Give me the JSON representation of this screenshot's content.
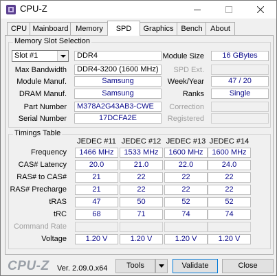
{
  "window": {
    "title": "CPU-Z",
    "icon": "cpu-z-app-icon"
  },
  "tabs": [
    {
      "label": "CPU"
    },
    {
      "label": "Mainboard"
    },
    {
      "label": "Memory"
    },
    {
      "label": "SPD",
      "active": true
    },
    {
      "label": "Graphics"
    },
    {
      "label": "Bench"
    },
    {
      "label": "About"
    }
  ],
  "slot": {
    "group_title": "Memory Slot Selection",
    "selected": "Slot #1",
    "type": "DDR4",
    "module_size_label": "Module Size",
    "module_size": "16 GBytes",
    "max_bandwidth_label": "Max Bandwidth",
    "max_bandwidth": "DDR4-3200 (1600 MHz)",
    "spd_ext_label": "SPD Ext.",
    "spd_ext": "",
    "manuf_label": "Module Manuf.",
    "manuf": "Samsung",
    "week_year_label": "Week/Year",
    "week_year": "47 / 20",
    "dram_manuf_label": "DRAM Manuf.",
    "dram_manuf": "Samsung",
    "ranks_label": "Ranks",
    "ranks": "Single",
    "part_label": "Part Number",
    "part": "M378A2G43AB3-CWE",
    "correction_label": "Correction",
    "correction": "",
    "serial_label": "Serial Number",
    "serial": "17DCFA2E",
    "registered_label": "Registered",
    "registered": ""
  },
  "timings": {
    "group_title": "Timings Table",
    "columns": [
      "JEDEC #11",
      "JEDEC #12",
      "JEDEC #13",
      "JEDEC #14"
    ],
    "rows": [
      {
        "label": "Frequency",
        "values": [
          "1466 MHz",
          "1533 MHz",
          "1600 MHz",
          "1600 MHz"
        ]
      },
      {
        "label": "CAS# Latency",
        "values": [
          "20.0",
          "21.0",
          "22.0",
          "24.0"
        ]
      },
      {
        "label": "RAS# to CAS#",
        "values": [
          "21",
          "22",
          "22",
          "22"
        ]
      },
      {
        "label": "RAS# Precharge",
        "values": [
          "21",
          "22",
          "22",
          "22"
        ]
      },
      {
        "label": "tRAS",
        "values": [
          "47",
          "50",
          "52",
          "52"
        ]
      },
      {
        "label": "tRC",
        "values": [
          "68",
          "71",
          "74",
          "74"
        ]
      },
      {
        "label": "Command Rate",
        "values": [
          "",
          "",
          "",
          ""
        ],
        "disabled": true
      },
      {
        "label": "Voltage",
        "values": [
          "1.20 V",
          "1.20 V",
          "1.20 V",
          "1.20 V"
        ]
      }
    ]
  },
  "footer": {
    "logo": "CPU-Z",
    "version": "Ver. 2.09.0.x64",
    "tools_label": "Tools",
    "validate_label": "Validate",
    "close_label": "Close"
  },
  "colors": {
    "value_text": "#0a0a8a",
    "disabled_label": "#a0a0a0",
    "focus_border": "#0078d7"
  }
}
